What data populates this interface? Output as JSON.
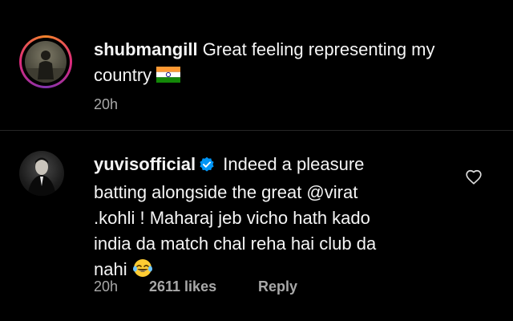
{
  "caption": {
    "username": "shubmangill",
    "text_line1": "Great feeling representing my",
    "text_line2": "country",
    "flag_icon": "india-flag-icon",
    "time": "20h"
  },
  "comment": {
    "username": "yuvisofficial",
    "verified_icon": "verified-badge-icon",
    "text_line1": "Indeed a pleasure",
    "text_line2": "batting alongside the great @virat",
    "text_line3": ".kohli ! Maharaj jeb vicho hath kado",
    "text_line4": "india da match chal reha hai club da",
    "text_line5": "nahi",
    "emoji_icon": "tears-of-joy-emoji-icon",
    "time": "20h",
    "likes": "2611 likes",
    "reply_label": "Reply",
    "like_icon": "heart-icon"
  },
  "colors": {
    "background": "#000000",
    "primary_text": "#f5f5f5",
    "secondary_text": "#a8a8a8",
    "verified_blue": "#0095f6",
    "divider": "#262626"
  }
}
